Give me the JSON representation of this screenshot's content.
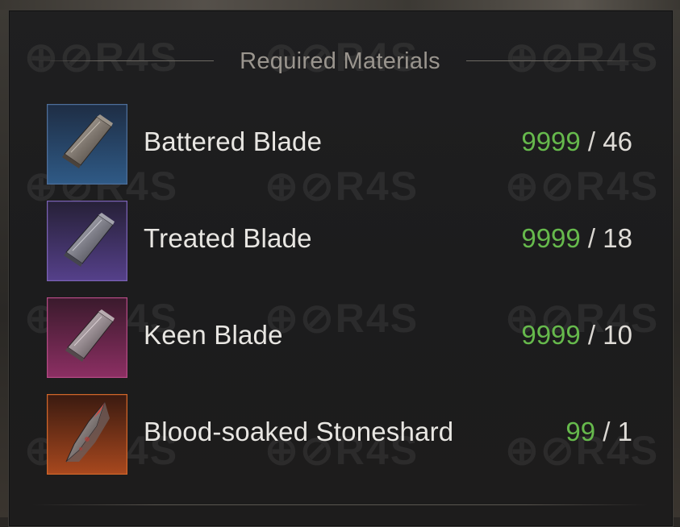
{
  "title": "Required Materials",
  "watermark_text": "R4S",
  "colors": {
    "have_quantity": "#66b94c",
    "name_text": "#e8e6e2",
    "header_text": "#9a958e",
    "panel_bg": "#1e1e1f"
  },
  "materials": [
    {
      "name": "Battered Blade",
      "have": "9999",
      "separator": " / ",
      "need": "46",
      "icon": "battered-blade-icon",
      "rarity_color": "#2b4c74"
    },
    {
      "name": "Treated Blade",
      "have": "9999",
      "separator": " / ",
      "need": "18",
      "icon": "treated-blade-icon",
      "rarity_color": "#4a3b7a"
    },
    {
      "name": "Keen Blade",
      "have": "9999",
      "separator": " / ",
      "need": "10",
      "icon": "keen-blade-icon",
      "rarity_color": "#7a2a57"
    },
    {
      "name": "Blood-soaked Stoneshard",
      "have": "99",
      "separator": " / ",
      "need": "1",
      "icon": "blood-soaked-stoneshard-icon",
      "rarity_color": "#8a3a1c"
    }
  ]
}
